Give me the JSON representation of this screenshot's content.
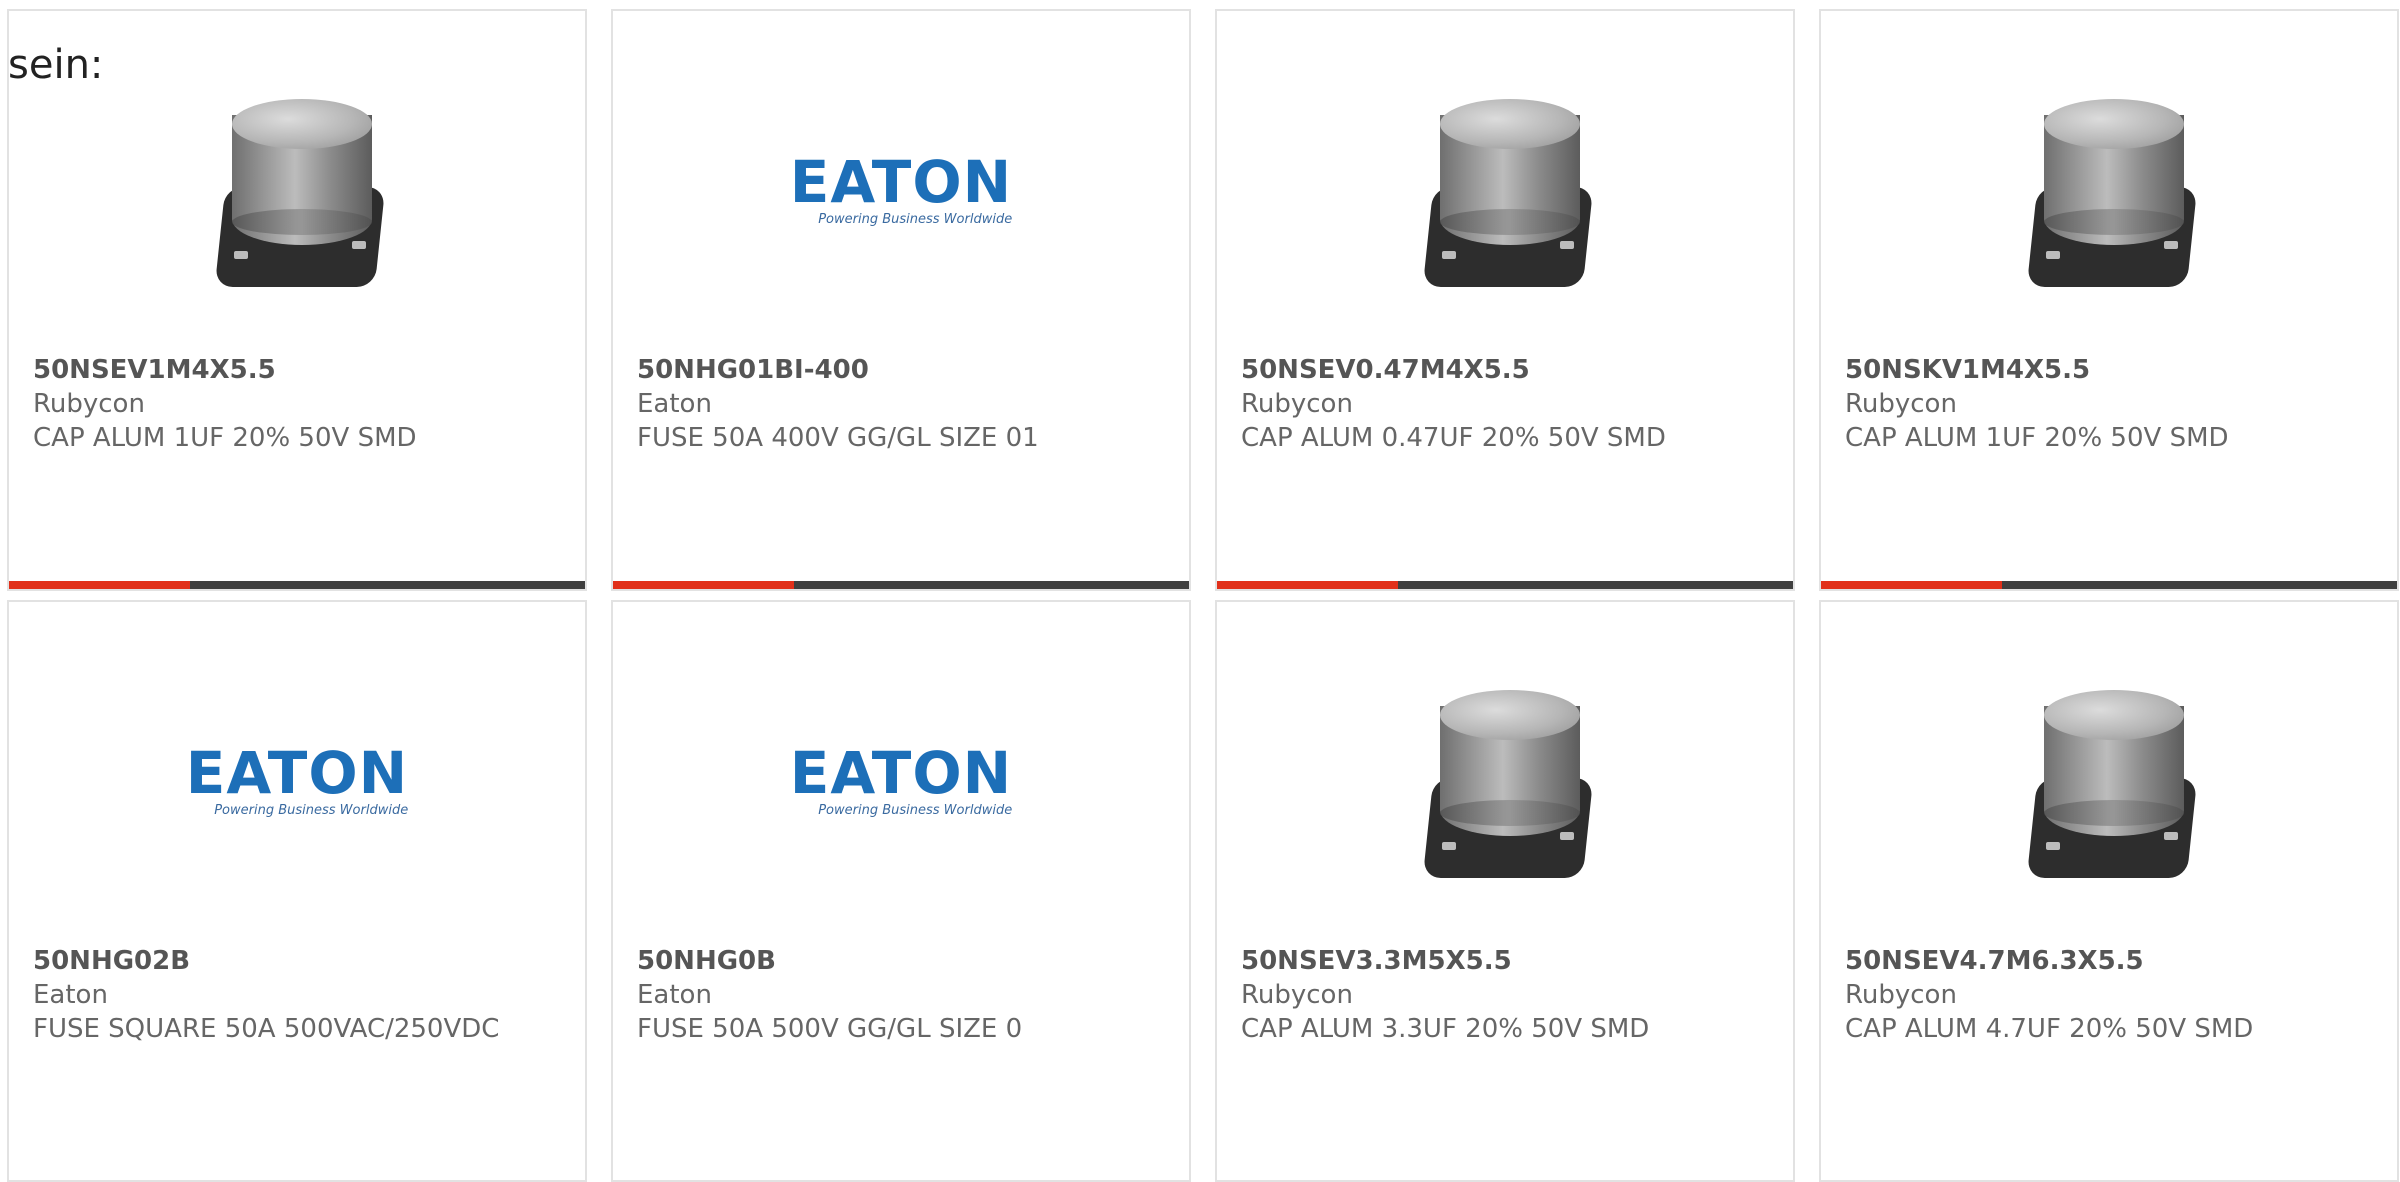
{
  "lead_text": "sein:",
  "accent_color": "#e1301a",
  "bar_color": "#3f3f3f",
  "products": [
    {
      "part_number": "50NSEV1M4X5.5",
      "manufacturer": "Rubycon",
      "description": "CAP ALUM 1UF 20% 50V SMD",
      "image": "capacitor-image",
      "progress": 0.315
    },
    {
      "part_number": "50NHG01BI-400",
      "manufacturer": "Eaton",
      "description": "FUSE 50A 400V GG/GL SIZE 01",
      "image": "eaton-logo",
      "logo_text": "EATON",
      "logo_tagline": "Powering Business Worldwide",
      "progress": 0.315
    },
    {
      "part_number": "50NSEV0.47M4X5.5",
      "manufacturer": "Rubycon",
      "description": "CAP ALUM 0.47UF 20% 50V SMD",
      "image": "capacitor-image",
      "progress": 0.315
    },
    {
      "part_number": "50NSKV1M4X5.5",
      "manufacturer": "Rubycon",
      "description": "CAP ALUM 1UF 20% 50V SMD",
      "image": "capacitor-image",
      "progress": 0.315
    },
    {
      "part_number": "50NHG02B",
      "manufacturer": "Eaton",
      "description": "FUSE SQUARE 50A 500VAC/250VDC",
      "image": "eaton-logo",
      "logo_text": "EATON",
      "logo_tagline": "Powering Business Worldwide"
    },
    {
      "part_number": "50NHG0B",
      "manufacturer": "Eaton",
      "description": "FUSE 50A 500V GG/GL SIZE 0",
      "image": "eaton-logo",
      "logo_text": "EATON",
      "logo_tagline": "Powering Business Worldwide"
    },
    {
      "part_number": "50NSEV3.3M5X5.5",
      "manufacturer": "Rubycon",
      "description": "CAP ALUM 3.3UF 20% 50V SMD",
      "image": "capacitor-image"
    },
    {
      "part_number": "50NSEV4.7M6.3X5.5",
      "manufacturer": "Rubycon",
      "description": "CAP ALUM 4.7UF 20% 50V SMD",
      "image": "capacitor-image"
    }
  ]
}
